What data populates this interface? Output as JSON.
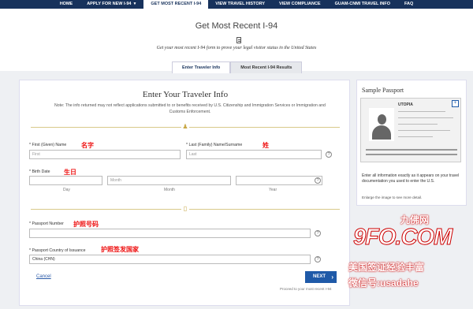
{
  "nav": {
    "items": [
      "HOME",
      "APPLY FOR NEW I-94",
      "GET MOST RECENT I-94",
      "VIEW TRAVEL HISTORY",
      "VIEW COMPLIANCE",
      "GUAM-CNMI TRAVEL INFO",
      "FAQ"
    ],
    "active_index": 2,
    "caret": "▼"
  },
  "header": {
    "title": "Get Most Recent I-94",
    "subtitle": "Get your most recent I-94 form to prove your legal visitor status in the United States",
    "tabs": [
      "Enter Traveler Info",
      "Most Recent I-94 Results"
    ],
    "active_tab": 0
  },
  "form": {
    "title": "Enter Your Traveler Info",
    "note": "Note: The info returned may not reflect applications submitted to or benefits received by U.S. Citizenship and Immigration Services or Immigration and Customs Enforcement.",
    "first_name_label": "* First (Given) Name",
    "first_name_cn": "名字",
    "first_name_placeholder": "First",
    "last_name_label": "* Last (Family) Name/Surname",
    "last_name_cn": "姓",
    "last_name_placeholder": "Last",
    "birth_date_label": "* Birth Date",
    "birth_date_cn": "生日",
    "day_label": "Day",
    "month_label": "Month",
    "year_label": "Year",
    "month_placeholder": "Month",
    "passport_number_label": "* Passport Number",
    "passport_number_cn": "护照号码",
    "passport_country_label": "* Passport Country of Issuance",
    "passport_country_cn": "护照签发国家",
    "passport_country_value": "China (CHN)",
    "help": "?",
    "cancel": "Cancel",
    "next": "NEXT",
    "next_arrow": "›",
    "proceed": "Proceed to your most recent I-94"
  },
  "sidebar": {
    "title": "Sample Passport",
    "passport_label": "UTOPIA",
    "zoom": "🔍",
    "text": "Enter all information exactly as it appears on your travel documentation you used to enter the U.S.",
    "small": "Enlarge the image to see more detail."
  },
  "watermark": {
    "line1": "九佛网",
    "line2": "9FO.COM",
    "line3": "美国签证经验丰富",
    "line4": "微信号:usadahe"
  },
  "colors": {
    "nav_bg": "#17325c",
    "accent": "#1f5aa8",
    "annotation_red": "#e11"
  }
}
